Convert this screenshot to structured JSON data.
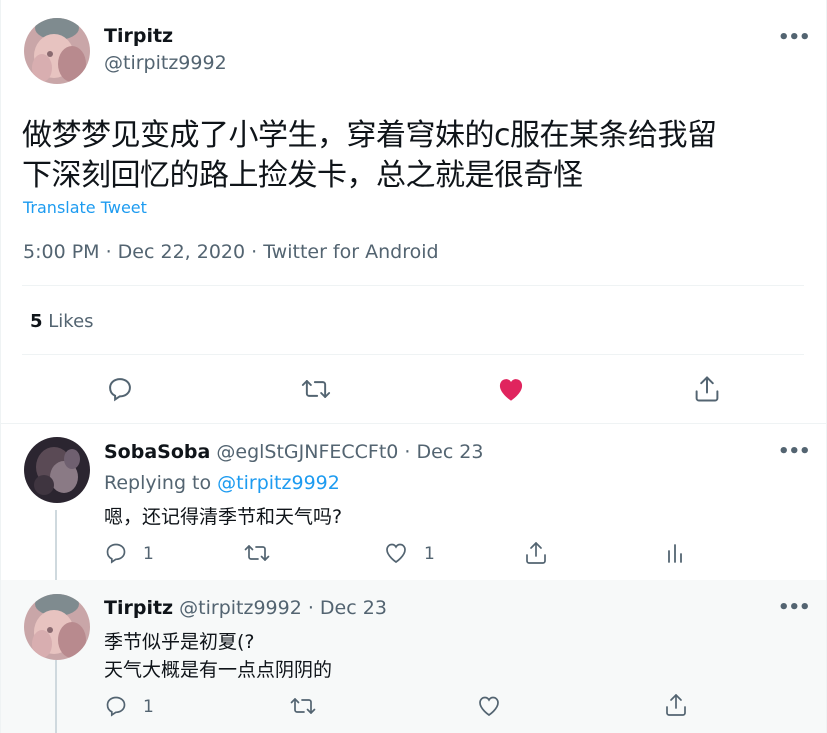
{
  "main_tweet": {
    "display_name": "Tirpitz",
    "handle": "@tirpitz9992",
    "text_line1": "做梦梦见变成了小学生，穿着穹妹的c服在某条给我留",
    "text_line2": "下深刻回忆的路上捡发卡，总之就是很奇怪",
    "translate_label": "Translate Tweet",
    "meta": "5:00 PM · Dec 22, 2020 · Twitter for Android",
    "likes_count": "5",
    "likes_label": "Likes",
    "more_label": "•••"
  },
  "reply1": {
    "display_name": "SobaSoba",
    "handle_date": "@eglStGJNFECCFt0 · Dec 23",
    "replying_prefix": "Replying to",
    "replying_handle": "@tirpitz9992",
    "text": "嗯，还记得清季节和天气吗?",
    "reply_count": "1",
    "like_count": "1",
    "more_label": "•••"
  },
  "reply2": {
    "display_name": "Tirpitz",
    "handle_date": "@tirpitz9992 · Dec 23",
    "text_line1": "季节似乎是初夏(?",
    "text_line2": "天气大概是有一点点阴阴的",
    "reply_count": "1",
    "more_label": "•••"
  },
  "colors": {
    "like_active": "#e0245e",
    "link": "#1d9bf0",
    "muted": "#536471",
    "highlight_bg": "#f7f9f9"
  },
  "icons": [
    "reply-icon",
    "retweet-icon",
    "like-icon",
    "share-icon",
    "analytics-icon",
    "more-icon"
  ]
}
